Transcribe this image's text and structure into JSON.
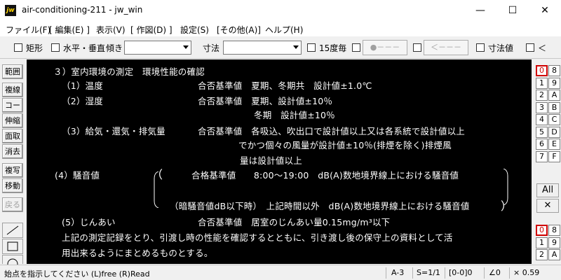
{
  "window": {
    "app_icon": "jw",
    "title": "air-conditioning-211 - jw_win",
    "min": "—",
    "max": "☐",
    "close": "✕"
  },
  "menu": [
    "ファイル(F)",
    "[ 編集(E) ]",
    "表示(V)",
    "[ 作図(D) ]",
    "設定(S)",
    "[その他(A)]",
    "ヘルプ(H)"
  ],
  "toolbar": {
    "rect": "矩形",
    "hv": "水平・垂直",
    "tilt": "傾き",
    "dim": "寸法",
    "deg15": "15度毎",
    "btn1": "●－－－",
    "btn2": "＜－－－",
    "dimval": "寸法値",
    "lt": "＜"
  },
  "lefttools": [
    "範囲",
    "複線",
    "コーナー",
    "伸縮",
    "面取",
    "消去",
    "複写",
    "移動",
    "戻る"
  ],
  "canvas": {
    "lines": [
      "３）室内環境の測定　環境性能の確認",
      "（1）温度",
      "合否基準値　夏期、冬期共　設計値±1.0℃",
      "（2）湿度",
      "合否基準値　夏期、設計値±10％",
      "冬期　設計値±10％",
      "（3）給気・還気・排気量",
      "合否基準値　各吸込、吹出口で設計値以上又は各系統で設計値以上",
      "でかつ個々の風量が設計値±10％(排煙を除く)排煙風",
      "量は設計値以上",
      "(4）騒音値",
      "合格基準値　　8:00～19:00　dB(A)数地境界線上における騒音値",
      "（暗騒音値dB以下時）　上記時間以外　dB(A)数地境界線上における騒音値",
      "(5）じんあい",
      "合否基準値　居室のじんあい量0.15mg/m³以下",
      "上記の測定記録をとり、引渡し時の性能を確認するとともに、引き渡し後の保守上の資料として活",
      "用出来るようにまとめるものとする。",
      "（",
      "）"
    ]
  },
  "layers_top": [
    [
      "0",
      "8"
    ],
    [
      "1",
      "9"
    ],
    [
      "2",
      "A"
    ],
    [
      "3",
      "B"
    ],
    [
      "4",
      "C"
    ],
    [
      "5",
      "D"
    ],
    [
      "6",
      "E"
    ],
    [
      "7",
      "F"
    ]
  ],
  "layers_bottom": [
    [
      "0",
      "8"
    ],
    [
      "1",
      "9"
    ],
    [
      "2",
      "A"
    ]
  ],
  "right_all": "All",
  "right_x": "✕",
  "status": {
    "msg": "始点を指示してください (L)free (R)Read",
    "paper": "A-3",
    "scale": "S=1/1",
    "group": "[0-0]0",
    "angle": "∠0",
    "zoom": "× 0.59"
  },
  "colors": {
    "canvas_bg": "#000000",
    "canvas_text": "#ffffff",
    "selected_layer": "#d00000"
  }
}
